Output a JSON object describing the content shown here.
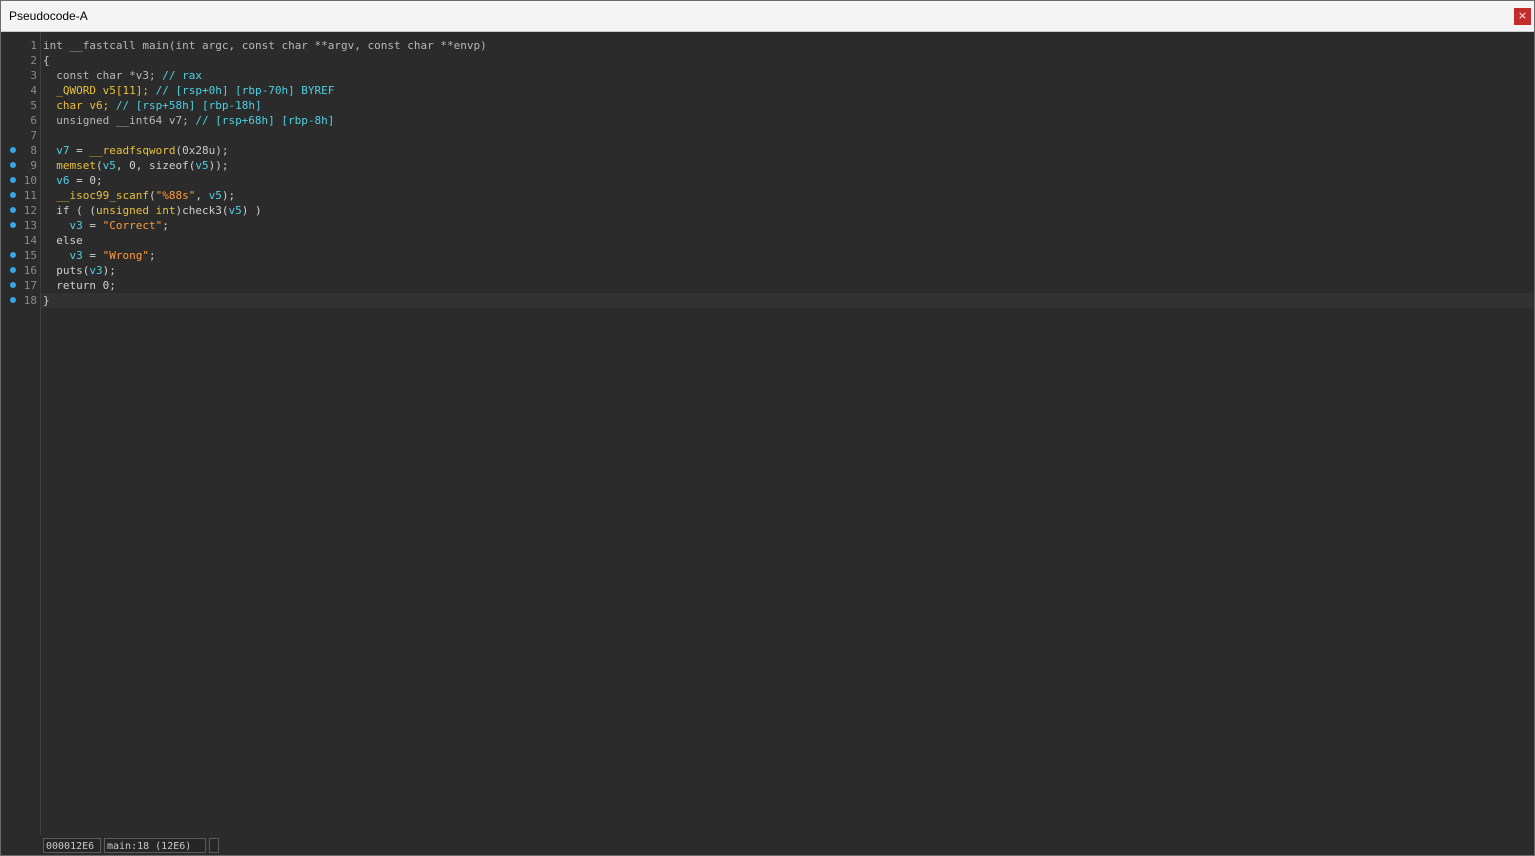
{
  "window": {
    "title": "Pseudocode-A",
    "close_label": "×"
  },
  "code": {
    "lines": [
      {
        "num": "1",
        "bp": false
      },
      {
        "num": "2",
        "bp": false
      },
      {
        "num": "3",
        "bp": false
      },
      {
        "num": "4",
        "bp": false
      },
      {
        "num": "5",
        "bp": false
      },
      {
        "num": "6",
        "bp": false
      },
      {
        "num": "7",
        "bp": false
      },
      {
        "num": "8",
        "bp": true
      },
      {
        "num": "9",
        "bp": true
      },
      {
        "num": "10",
        "bp": true
      },
      {
        "num": "11",
        "bp": true
      },
      {
        "num": "12",
        "bp": true
      },
      {
        "num": "13",
        "bp": true
      },
      {
        "num": "14",
        "bp": false
      },
      {
        "num": "15",
        "bp": true
      },
      {
        "num": "16",
        "bp": true
      },
      {
        "num": "17",
        "bp": true
      },
      {
        "num": "18",
        "bp": true
      }
    ],
    "text": {
      "l1_int": "int",
      "l1_fastcall": "__fastcall",
      "l1_main": "main",
      "l1_args": "(int argc, const char **argv, const char **envp)",
      "l2": "{",
      "l3_decl": "const char *v3;",
      "l3_cm": "// rax",
      "l4_ty": "_QWORD",
      "l4_var": "v5[11];",
      "l4_cm": "// [rsp+0h] [rbp-70h] BYREF",
      "l5_ty": "char",
      "l5_var": "v6;",
      "l5_cm": "// [rsp+58h] [rbp-18h]",
      "l6_decl": "unsigned __int64 v7;",
      "l6_cm": "// [rsp+68h] [rbp-8h]",
      "l8_var": "v7",
      "l8_eq": " = ",
      "l8_fn": "__readfsqword",
      "l8_args": "(0x28u);",
      "l9_fn": "memset",
      "l9_p1": "(",
      "l9_v5": "v5",
      "l9_mid": ", 0, sizeof(",
      "l9_v5b": "v5",
      "l9_end": "));",
      "l10_var": "v6",
      "l10_rest": " = 0;",
      "l11_fn": "__isoc99_scanf",
      "l11_p1": "(",
      "l11_str": "\"%88s\"",
      "l11_mid": ", ",
      "l11_v5": "v5",
      "l11_end": ");",
      "l12_if": "if ( (",
      "l12_ty": "unsigned int",
      "l12_fn": ")check3(",
      "l12_v5": "v5",
      "l12_end": ") )",
      "l13_var": "v3",
      "l13_eq": " = ",
      "l13_str": "\"Correct\"",
      "l13_end": ";",
      "l14": "else",
      "l15_var": "v3",
      "l15_eq": " = ",
      "l15_str": "\"Wrong\"",
      "l15_end": ";",
      "l16_fn": "puts(",
      "l16_var": "v3",
      "l16_end": ");",
      "l17": "return 0;",
      "l18": "}"
    }
  },
  "status": {
    "address": "000012E6",
    "location": "main:18 (12E6)",
    "extra": ""
  }
}
